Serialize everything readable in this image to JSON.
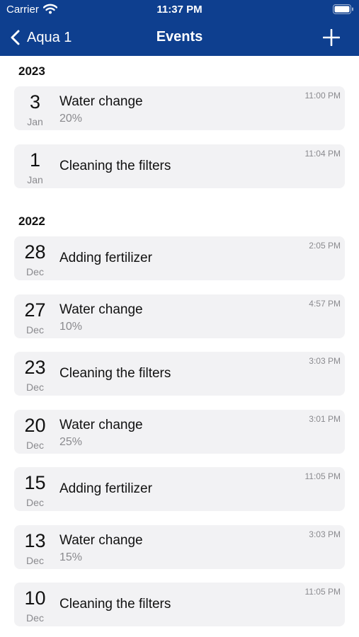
{
  "status_bar": {
    "carrier": "Carrier",
    "time": "11:37 PM"
  },
  "nav": {
    "back_label": "Aqua 1",
    "title": "Events"
  },
  "sections": [
    {
      "year": "2023",
      "events": [
        {
          "day": "3",
          "month": "Jan",
          "title": "Water change",
          "detail": "20%",
          "time": "11:00 PM"
        },
        {
          "day": "1",
          "month": "Jan",
          "title": "Cleaning the filters",
          "time": "11:04 PM"
        }
      ]
    },
    {
      "year": "2022",
      "events": [
        {
          "day": "28",
          "month": "Dec",
          "title": "Adding fertilizer",
          "time": "2:05 PM"
        },
        {
          "day": "27",
          "month": "Dec",
          "title": "Water change",
          "detail": "10%",
          "time": "4:57 PM"
        },
        {
          "day": "23",
          "month": "Dec",
          "title": "Cleaning the filters",
          "time": "3:03 PM"
        },
        {
          "day": "20",
          "month": "Dec",
          "title": "Water change",
          "detail": "25%",
          "time": "3:01 PM"
        },
        {
          "day": "15",
          "month": "Dec",
          "title": "Adding fertilizer",
          "time": "11:05 PM"
        },
        {
          "day": "13",
          "month": "Dec",
          "title": "Water change",
          "detail": "15%",
          "time": "3:03 PM"
        },
        {
          "day": "10",
          "month": "Dec",
          "title": "Cleaning the filters",
          "time": "11:05 PM"
        }
      ]
    }
  ],
  "colors": {
    "header": "#0e3f8f",
    "card": "#f2f2f4",
    "secondary_text": "#8a8a8e"
  },
  "icons": {
    "back": "chevron-left-icon",
    "add": "plus-icon",
    "wifi": "wifi-icon",
    "battery": "battery-icon"
  }
}
